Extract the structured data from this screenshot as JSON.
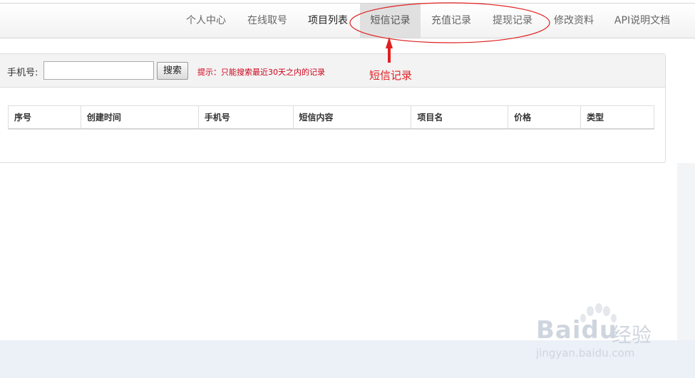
{
  "nav": {
    "items": [
      {
        "label": "个人中心"
      },
      {
        "label": "在线取号"
      },
      {
        "label": "项目列表"
      },
      {
        "label": "短信记录"
      },
      {
        "label": "充值记录"
      },
      {
        "label": "提现记录"
      },
      {
        "label": "修改资料"
      },
      {
        "label": "API说明文档"
      }
    ],
    "active_label": "短信记录"
  },
  "search": {
    "label": "手机号:",
    "value": "",
    "placeholder": "",
    "button_label": "搜索",
    "hint": "提示：只能搜索最近30天之内的记录"
  },
  "table": {
    "columns": [
      "序号",
      "创建时间",
      "手机号",
      "短信内容",
      "项目名",
      "价格",
      "类型"
    ],
    "rows": []
  },
  "annotation": {
    "label": "短信记录",
    "color": "#e02020"
  },
  "watermark": {
    "brand": "Bai",
    "brand2": "du",
    "cn": "经验",
    "url": "jingyan.baidu.com"
  }
}
